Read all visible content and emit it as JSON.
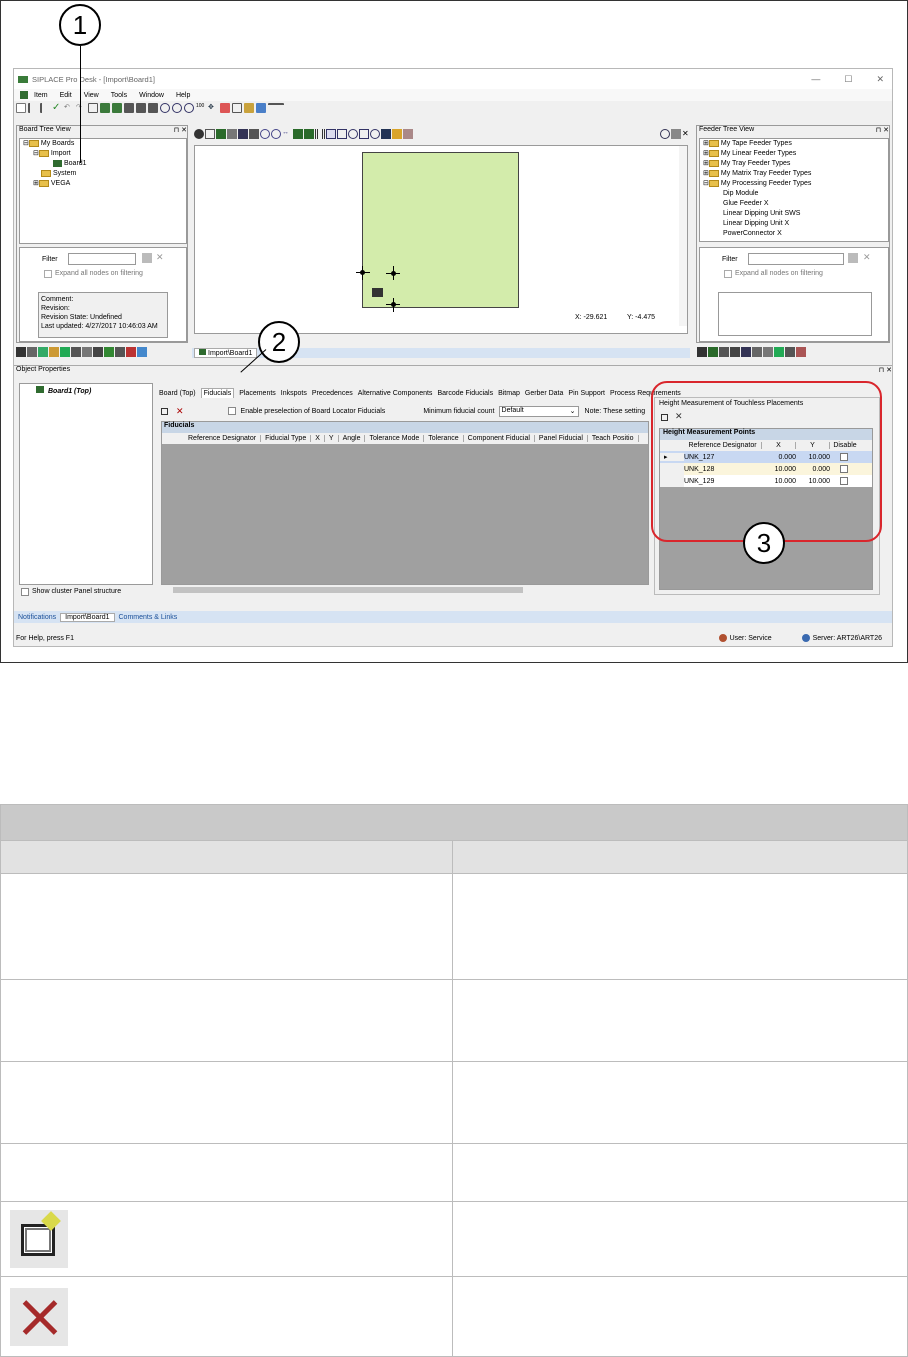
{
  "callouts": [
    "1",
    "2",
    "3"
  ],
  "window": {
    "title": "SIPLACE Pro Desk - [Import\\Board1]",
    "controls": [
      "—",
      "☐",
      "✕"
    ],
    "menu": [
      "Item",
      "Edit",
      "View",
      "Tools",
      "Window",
      "Help"
    ],
    "status_left": "For Help, press F1",
    "status_user": "User:  Service",
    "status_server": "Server:  ART26\\ART26"
  },
  "board_tree": {
    "title": "Board Tree View",
    "nodes": [
      "My Boards",
      "Import",
      "Board1",
      "System",
      "VEGA"
    ],
    "filter_label": "Filter",
    "expand_label": "Expand all nodes on filtering",
    "comment_lines": [
      "Comment:",
      "Revision:",
      "Revision State: Undefined",
      "Last updated: 4/27/2017 10:46:03 AM"
    ]
  },
  "canvas": {
    "x_label": "X:  -29.621",
    "y_label": "Y:  -4.475",
    "doc_tab": "Import\\Board1"
  },
  "feeder_tree": {
    "title": "Feeder Tree View",
    "nodes": [
      "My Tape Feeder Types",
      "My Linear Feeder Types",
      "My Tray Feeder Types",
      "My Matrix Tray Feeder Types",
      "My Processing Feeder Types",
      "Dip Module",
      "Glue Feeder X",
      "Linear Dipping Unit SWS",
      "Linear Dipping Unit X",
      "PowerConnector X"
    ],
    "filter_label": "Filter",
    "expand_label": "Expand all nodes on filtering"
  },
  "object_props": {
    "title": "Object Properties",
    "board_item": "Board1 (Top)",
    "cluster_label": "Show cluster Panel structure",
    "tabs": [
      "Board (Top)",
      "Fiducials",
      "Placements",
      "Inkspots",
      "Precedences",
      "Alternative Components",
      "Barcode Fiducials",
      "Bitmap",
      "Gerber Data",
      "Pin Support",
      "Process Requirements"
    ],
    "enable_label": "Enable preselection of Board Locator Fiducials",
    "min_fid_label": "Minimum fiducial count",
    "min_fid_value": "Default",
    "note": "Note: These setting",
    "fiducials_header": "Fiducials",
    "columns": [
      "Reference Designator",
      "Fiducial Type",
      "X",
      "Y",
      "Angle",
      "Tolerance Mode",
      "Tolerance",
      "Component Fiducial",
      "Panel Fiducial",
      "Teach Positio"
    ],
    "bottom_tabs": [
      "Notifications",
      "Import\\Board1",
      "Comments & Links"
    ]
  },
  "height_panel": {
    "group_title": "Height Measurement of Touchless Placements",
    "grid_title": "Height Measurement Points",
    "columns": [
      "Reference Designator",
      "X",
      "Y",
      "Disable"
    ],
    "rows": [
      {
        "ref": "UNK_127",
        "x": "0.000",
        "y": "10.000"
      },
      {
        "ref": "UNK_128",
        "x": "10.000",
        "y": "0.000"
      },
      {
        "ref": "UNK_129",
        "x": "10.000",
        "y": "10.000"
      }
    ]
  },
  "table": {
    "rows": 8
  }
}
